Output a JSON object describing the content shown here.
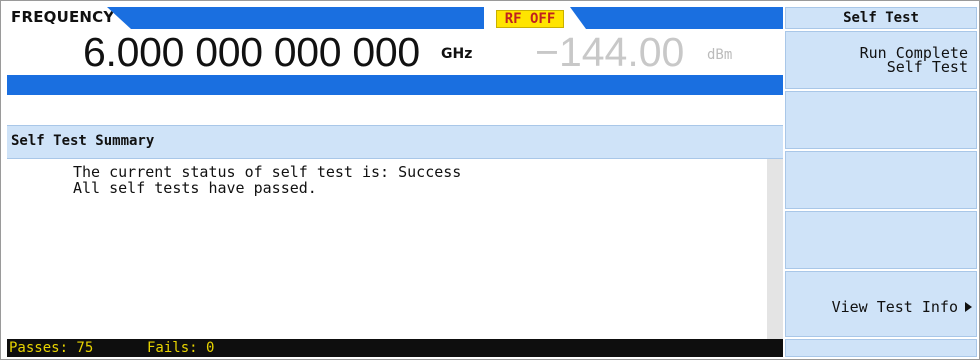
{
  "header": {
    "frequency_label": "FREQUENCY",
    "frequency_value": "6.000 000 000 000",
    "frequency_unit": "GHz",
    "rf_status": "RF OFF",
    "amplitude_value": "−144.00",
    "amplitude_unit": "dBm"
  },
  "summary": {
    "title": "Self Test Summary",
    "line1": "The current status of self test is: Success",
    "line2": "All self tests have passed."
  },
  "status_bar": {
    "passes": "Passes: 75",
    "fails": "Fails: 0"
  },
  "softkeys": {
    "menu_title": "Self Test",
    "run_complete_line1": "Run Complete",
    "run_complete_line2": "Self Test",
    "view_test_info": "View Test Info",
    "submenu_icon": "right-triangle-icon"
  },
  "colors": {
    "accent_blue": "#1a6fe0",
    "softkey_bg": "#cfe3f8",
    "rf_off_bg": "#ffe400",
    "rf_off_text": "#c02020",
    "status_text": "#e8d400"
  }
}
